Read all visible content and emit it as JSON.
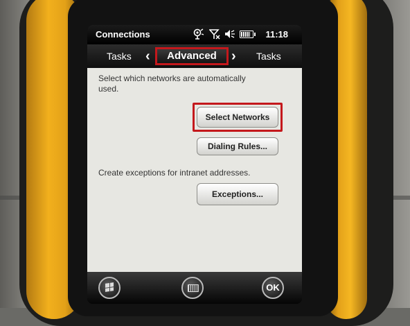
{
  "status_bar": {
    "title": "Connections",
    "time": "11:18",
    "icons": [
      "connectivity-icon",
      "no-signal-icon",
      "volume-mute-icon",
      "battery-icon"
    ]
  },
  "tabs": {
    "previous": "Tasks",
    "active": "Advanced",
    "next": "Tasks",
    "chevron_left": "‹",
    "chevron_right": "›"
  },
  "content": {
    "description_networks": "Select which networks are automatically used.",
    "select_networks_label": "Select Networks",
    "dialing_rules_label": "Dialing Rules...",
    "description_exceptions": "Create exceptions for intranet addresses.",
    "exceptions_label": "Exceptions..."
  },
  "softkeys": {
    "start_icon": "windows-start-icon",
    "keyboard_icon": "keyboard-icon",
    "ok_label": "OK"
  },
  "colors": {
    "highlight": "#c4181c",
    "content_background": "#e7e7e2",
    "device_bumper": "#f2b01d"
  }
}
